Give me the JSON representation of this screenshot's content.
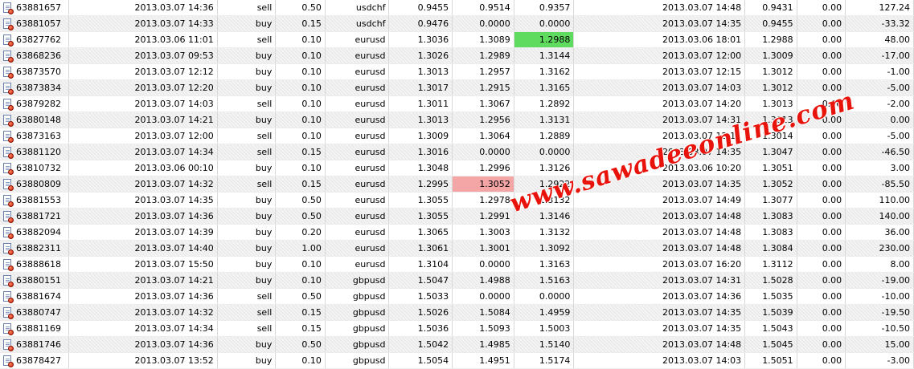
{
  "colors": {
    "row_alt": "#f4f4f4",
    "highlight_green": "#5fdc5f",
    "highlight_red": "#f4a6a6",
    "watermark": "#e8140c"
  },
  "icon_name": "order-icon",
  "watermark": "www.sawadeeonline.com",
  "rows": [
    [
      "63881657",
      "2013.03.07 14:36",
      "sell",
      "0.50",
      "usdchf",
      "0.9455",
      "0.9514",
      "0.9357",
      "2013.03.07 14:48",
      "0.9431",
      "0.00",
      "127.24"
    ],
    [
      "63881057",
      "2013.03.07 14:33",
      "buy",
      "0.15",
      "usdchf",
      "0.9476",
      "0.0000",
      "0.0000",
      "2013.03.07 14:35",
      "0.9455",
      "0.00",
      "-33.32"
    ],
    [
      "63827762",
      "2013.03.06 11:01",
      "sell",
      "0.10",
      "eurusd",
      "1.3036",
      "1.3089",
      "1.2988",
      "2013.03.06 18:01",
      "1.2988",
      "0.00",
      "48.00"
    ],
    [
      "63868236",
      "2013.03.07 09:53",
      "buy",
      "0.10",
      "eurusd",
      "1.3026",
      "1.2989",
      "1.3144",
      "2013.03.07 12:00",
      "1.3009",
      "0.00",
      "-17.00"
    ],
    [
      "63873570",
      "2013.03.07 12:12",
      "buy",
      "0.10",
      "eurusd",
      "1.3013",
      "1.2957",
      "1.3162",
      "2013.03.07 12:15",
      "1.3012",
      "0.00",
      "-1.00"
    ],
    [
      "63873834",
      "2013.03.07 12:20",
      "buy",
      "0.10",
      "eurusd",
      "1.3017",
      "1.2915",
      "1.3165",
      "2013.03.07 14:03",
      "1.3012",
      "0.00",
      "-5.00"
    ],
    [
      "63879282",
      "2013.03.07 14:03",
      "sell",
      "0.10",
      "eurusd",
      "1.3011",
      "1.3067",
      "1.2892",
      "2013.03.07 14:20",
      "1.3013",
      "0.00",
      "-2.00"
    ],
    [
      "63880148",
      "2013.03.07 14:21",
      "buy",
      "0.10",
      "eurusd",
      "1.3013",
      "1.2956",
      "1.3131",
      "2013.03.07 14:31",
      "1.3013",
      "0.00",
      "0.00"
    ],
    [
      "63873163",
      "2013.03.07 12:00",
      "sell",
      "0.10",
      "eurusd",
      "1.3009",
      "1.3064",
      "1.2889",
      "2013.03.07 12:12",
      "1.3014",
      "0.00",
      "-5.00"
    ],
    [
      "63881120",
      "2013.03.07 14:34",
      "sell",
      "0.15",
      "eurusd",
      "1.3016",
      "0.0000",
      "0.0000",
      "2013.03.07 14:35",
      "1.3047",
      "0.00",
      "-46.50"
    ],
    [
      "63810732",
      "2013.03.06 00:10",
      "buy",
      "0.10",
      "eurusd",
      "1.3048",
      "1.2996",
      "1.3126",
      "2013.03.06 10:20",
      "1.3051",
      "0.00",
      "3.00"
    ],
    [
      "63880809",
      "2013.03.07 14:32",
      "sell",
      "0.15",
      "eurusd",
      "1.2995",
      "1.3052",
      "1.2922",
      "2013.03.07 14:35",
      "1.3052",
      "0.00",
      "-85.50"
    ],
    [
      "63881553",
      "2013.03.07 14:35",
      "buy",
      "0.50",
      "eurusd",
      "1.3055",
      "1.2978",
      "1.3132",
      "2013.03.07 14:49",
      "1.3077",
      "0.00",
      "110.00"
    ],
    [
      "63881721",
      "2013.03.07 14:36",
      "buy",
      "0.50",
      "eurusd",
      "1.3055",
      "1.2991",
      "1.3146",
      "2013.03.07 14:48",
      "1.3083",
      "0.00",
      "140.00"
    ],
    [
      "63882094",
      "2013.03.07 14:39",
      "buy",
      "0.20",
      "eurusd",
      "1.3065",
      "1.3003",
      "1.3132",
      "2013.03.07 14:48",
      "1.3083",
      "0.00",
      "36.00"
    ],
    [
      "63882311",
      "2013.03.07 14:40",
      "buy",
      "1.00",
      "eurusd",
      "1.3061",
      "1.3001",
      "1.3092",
      "2013.03.07 14:48",
      "1.3084",
      "0.00",
      "230.00"
    ],
    [
      "63888618",
      "2013.03.07 15:50",
      "buy",
      "0.10",
      "eurusd",
      "1.3104",
      "0.0000",
      "1.3163",
      "2013.03.07 16:20",
      "1.3112",
      "0.00",
      "8.00"
    ],
    [
      "63880151",
      "2013.03.07 14:21",
      "buy",
      "0.10",
      "gbpusd",
      "1.5047",
      "1.4988",
      "1.5163",
      "2013.03.07 14:31",
      "1.5028",
      "0.00",
      "-19.00"
    ],
    [
      "63881674",
      "2013.03.07 14:36",
      "sell",
      "0.50",
      "gbpusd",
      "1.5033",
      "0.0000",
      "0.0000",
      "2013.03.07 14:36",
      "1.5035",
      "0.00",
      "-10.00"
    ],
    [
      "63880747",
      "2013.03.07 14:32",
      "sell",
      "0.15",
      "gbpusd",
      "1.5026",
      "1.5084",
      "1.4959",
      "2013.03.07 14:35",
      "1.5039",
      "0.00",
      "-19.50"
    ],
    [
      "63881169",
      "2013.03.07 14:34",
      "sell",
      "0.15",
      "gbpusd",
      "1.5036",
      "1.5093",
      "1.5003",
      "2013.03.07 14:35",
      "1.5043",
      "0.00",
      "-10.50"
    ],
    [
      "63881746",
      "2013.03.07 14:36",
      "buy",
      "0.50",
      "gbpusd",
      "1.5042",
      "1.4985",
      "1.5140",
      "2013.03.07 14:48",
      "1.5045",
      "0.00",
      "15.00"
    ],
    [
      "63878427",
      "2013.03.07 13:52",
      "buy",
      "0.10",
      "gbpusd",
      "1.5054",
      "1.4951",
      "1.5174",
      "2013.03.07 14:03",
      "1.5051",
      "0.00",
      "-3.00"
    ]
  ],
  "highlights": [
    {
      "row": 2,
      "col": 7,
      "color": "green"
    },
    {
      "row": 11,
      "col": 6,
      "color": "red"
    }
  ]
}
